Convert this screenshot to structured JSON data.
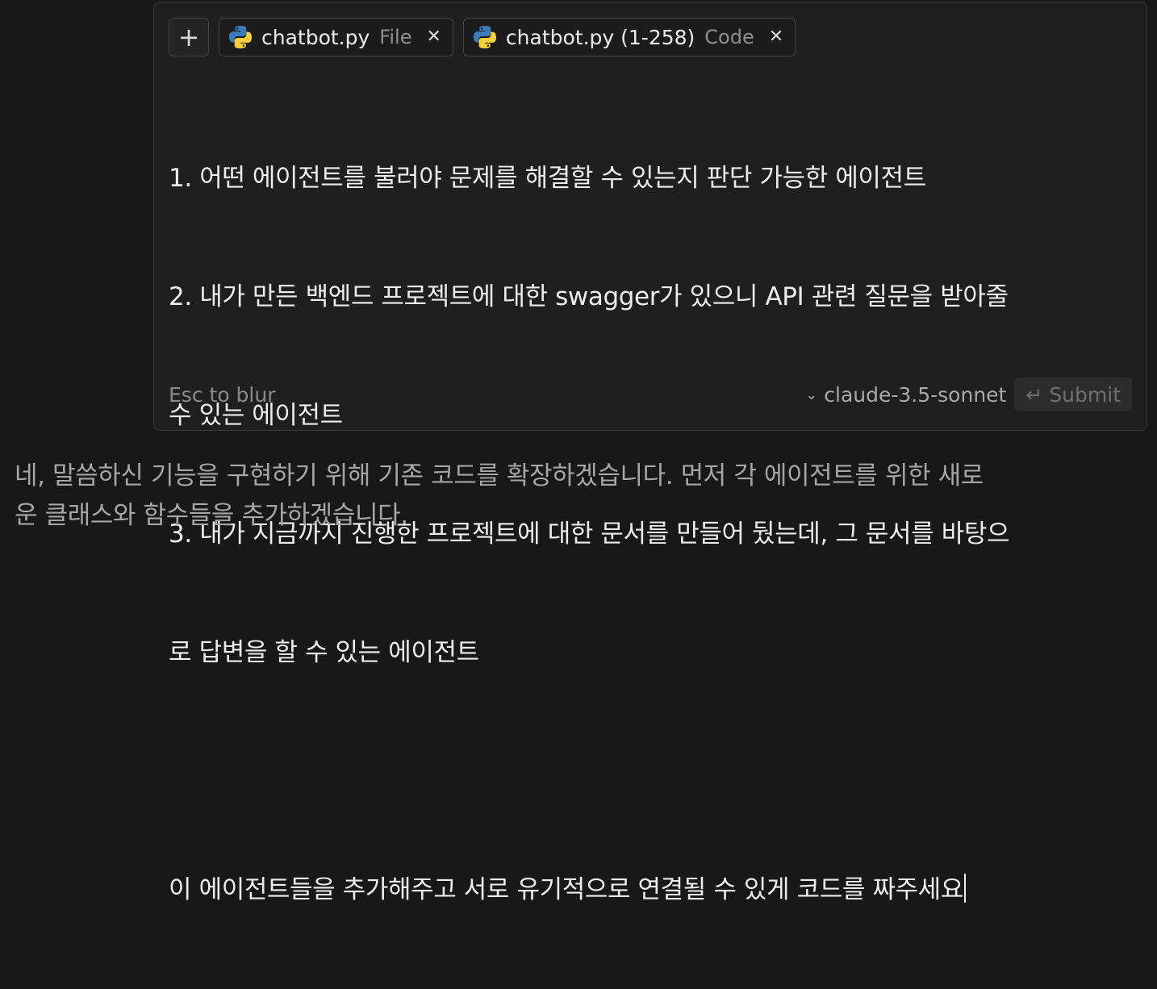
{
  "composer": {
    "attachments": [
      {
        "name": "chatbot.py",
        "kind": "File",
        "icon": "python-icon"
      },
      {
        "name": "chatbot.py (1-258)",
        "kind": "Code",
        "icon": "python-icon"
      }
    ],
    "prompt_lines": [
      "1. 어떤 에이전트를 불러야 문제를 해결할 수 있는지 판단 가능한 에이전트",
      "2. 내가 만든 백엔드 프로젝트에 대한 swagger가 있으니 API 관련 질문을 받아줄",
      "수 있는 에이전트",
      "3. 내가 지금까지 진행한 프로젝트에 대한 문서를 만들어 뒀는데, 그 문서를 바탕으",
      "로 답변을 할 수 있는 에이전트",
      "",
      "이 에이전트들을 추가해주고 서로 유기적으로 연결될 수 있게 코드를 짜주세요"
    ],
    "esc_hint": "Esc to blur",
    "model": "claude-3.5-sonnet",
    "submit_label": "Submit",
    "submit_icon": "↵"
  },
  "response": {
    "lines": [
      "네, 말씀하신 기능을 구현하기 위해 기존 코드를 확장하겠습니다. 먼저 각 에이전트를 위한 새로",
      "운 클래스와 함수들을 추가하겠습니다."
    ]
  },
  "colors": {
    "background": "#181818",
    "panel": "#1f1f1f",
    "text": "#ececec",
    "muted": "#8a8a8a"
  }
}
